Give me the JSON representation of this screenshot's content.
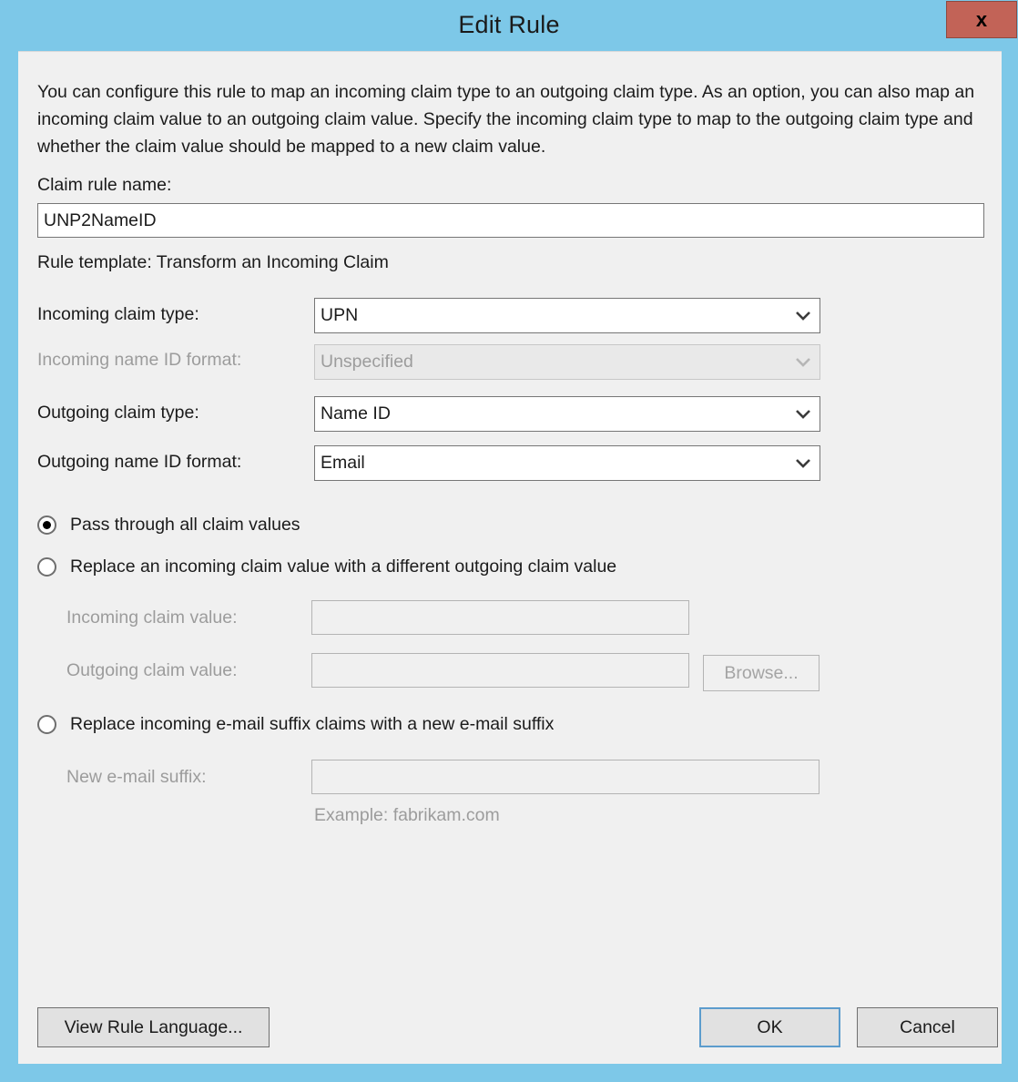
{
  "window": {
    "title": "Edit Rule",
    "close_label": "x",
    "titlebar_color": "#7dc8e8",
    "close_button_color": "#c26357",
    "content_color": "#f0f0f0",
    "accent_color": "#5c9ccd"
  },
  "description": "You can configure this rule to map an incoming claim type to an outgoing claim type. As an option, you can also map an incoming claim value to an outgoing claim value. Specify the incoming claim type to map to the outgoing claim type and whether the claim value should be mapped to a new claim value.",
  "claim_rule_name": {
    "label": "Claim rule name:",
    "value": "UNP2NameID",
    "placeholder": ""
  },
  "rule_template": "Rule template: Transform an Incoming Claim",
  "fields": [
    {
      "label": "Incoming claim type:",
      "value": "UPN",
      "disabled": false
    },
    {
      "label": "Incoming name ID format:",
      "value": "Unspecified",
      "disabled": true
    },
    {
      "label": "Outgoing claim type:",
      "value": "Name ID",
      "disabled": false
    },
    {
      "label": "Outgoing name ID format:",
      "value": "Email",
      "disabled": false
    }
  ],
  "options": [
    {
      "label": "Pass through all claim values",
      "selected": true
    },
    {
      "label": "Replace an incoming claim value with a different outgoing claim value",
      "selected": false
    },
    {
      "label": "Replace incoming e-mail suffix claims with a new e-mail suffix",
      "selected": false
    }
  ],
  "replace_value_fields": {
    "incoming_label": "Incoming claim value:",
    "incoming_value": "",
    "outgoing_label": "Outgoing claim value:",
    "outgoing_value": "",
    "browse_label": "Browse..."
  },
  "suffix_fields": {
    "label": "New e-mail suffix:",
    "value": "",
    "example": "Example: fabrikam.com"
  },
  "footer": {
    "view_rule_language": "View Rule Language...",
    "ok": "OK",
    "cancel": "Cancel"
  }
}
